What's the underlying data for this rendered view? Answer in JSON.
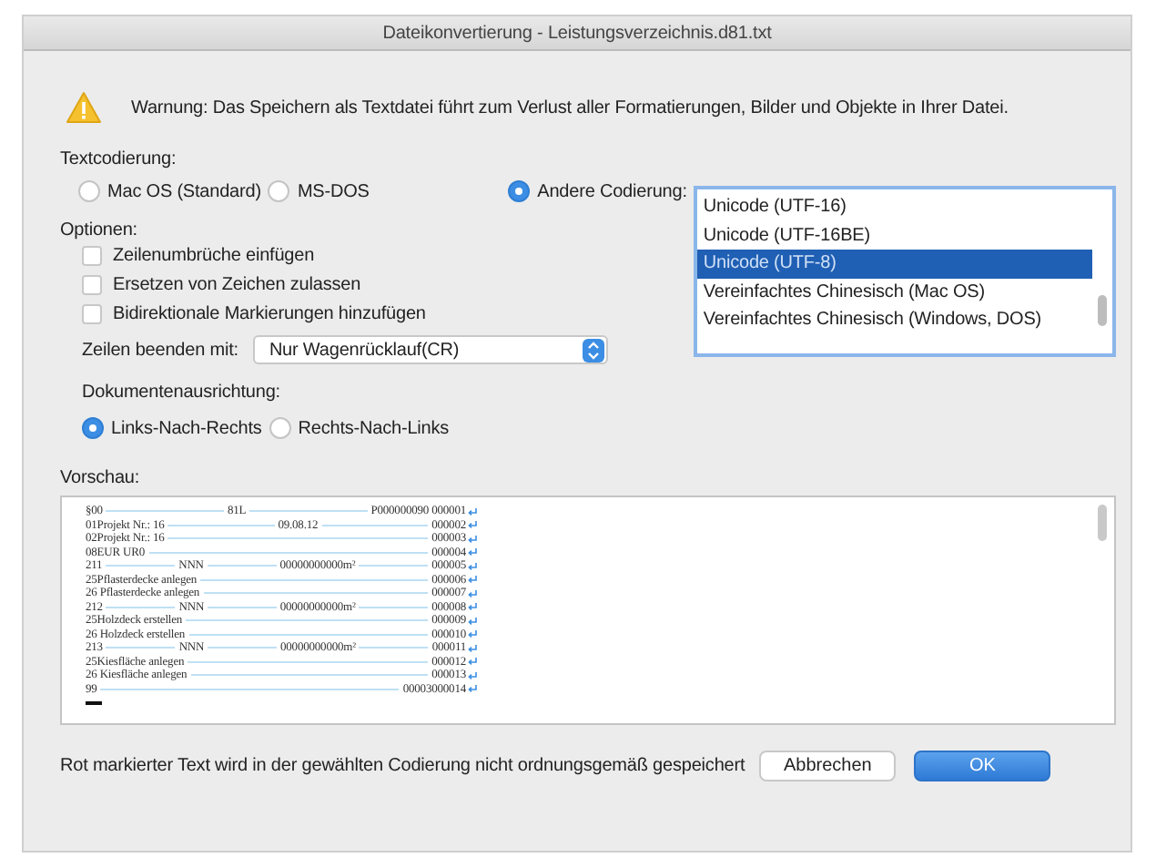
{
  "window": {
    "title": "Dateikonvertierung - Leistungsverzeichnis.d81.txt"
  },
  "warning": {
    "text": "Warnung: Das Speichern als Textdatei führt zum Verlust aller Formatierungen, Bilder und Objekte in Ihrer Datei."
  },
  "encoding": {
    "label": "Textcodierung:",
    "options": [
      {
        "label": "Mac OS (Standard)",
        "selected": false
      },
      {
        "label": "MS-DOS",
        "selected": false
      },
      {
        "label": "Andere Codierung:",
        "selected": true
      }
    ],
    "list": [
      {
        "label": "Unicode (UTF-16)",
        "selected": false
      },
      {
        "label": "Unicode (UTF-16BE)",
        "selected": false
      },
      {
        "label": "Unicode (UTF-8)",
        "selected": true
      },
      {
        "label": "Vereinfachtes Chinesisch (Mac OS)",
        "selected": false
      },
      {
        "label": "Vereinfachtes Chinesisch (Windows, DOS)",
        "selected": false
      }
    ]
  },
  "options": {
    "label": "Optionen:",
    "checkboxes": [
      {
        "label": "Zeilenumbrüche einfügen",
        "checked": false
      },
      {
        "label": "Ersetzen von Zeichen zulassen",
        "checked": false
      },
      {
        "label": "Bidirektionale Markierungen hinzufügen",
        "checked": false
      }
    ],
    "line_end": {
      "label": "Zeilen beenden mit:",
      "value": "Nur Wagenrücklauf(CR)"
    },
    "direction": {
      "label": "Dokumentenausrichtung:",
      "options": [
        {
          "label": "Links-Nach-Rechts",
          "selected": true
        },
        {
          "label": "Rechts-Nach-Links",
          "selected": false
        }
      ]
    }
  },
  "preview": {
    "label": "Vorschau:",
    "lines": [
      [
        "§00",
        "81L",
        "P000000090 000001"
      ],
      [
        "01Projekt Nr.: 16",
        "09.08.12",
        "000002"
      ],
      [
        "02Projekt Nr.: 16",
        "000003"
      ],
      [
        "08EUR  UR0",
        "000004"
      ],
      [
        "211",
        "NNN",
        "00000000000m²",
        "000005"
      ],
      [
        "25Pflasterdecke anlegen",
        "000006"
      ],
      [
        "26  Pflasterdecke anlegen",
        "000007"
      ],
      [
        "212",
        "NNN",
        "00000000000m²",
        "000008"
      ],
      [
        "25Holzdeck erstellen",
        "000009"
      ],
      [
        "26  Holzdeck erstellen",
        "000010"
      ],
      [
        "213",
        "NNN",
        "00000000000m²",
        "000011"
      ],
      [
        "25Kiesfläche anlegen",
        "000012"
      ],
      [
        "26  Kiesfläche anlegen",
        "000013"
      ],
      [
        "99",
        "00003000014"
      ]
    ]
  },
  "footer": {
    "note": "Rot markierter Text wird in der gewählten Codierung nicht ordnungsgemäß gespeichert",
    "buttons": [
      {
        "label": "Abbrechen",
        "kind": "normal"
      },
      {
        "label": "OK",
        "kind": "default"
      }
    ]
  }
}
